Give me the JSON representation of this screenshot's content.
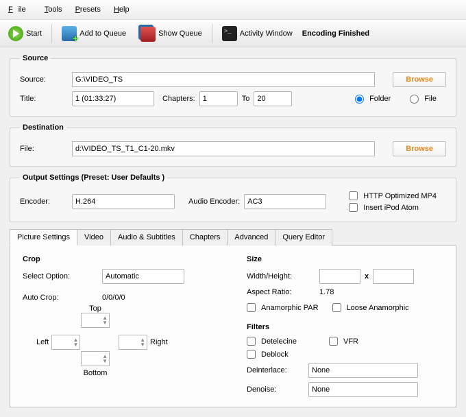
{
  "menu": {
    "file": "File",
    "tools": "Tools",
    "presets": "Presets",
    "help": "Help"
  },
  "toolbar": {
    "start": "Start",
    "add_queue": "Add to Queue",
    "show_queue": "Show Queue",
    "activity": "Activity Window",
    "status": "Encoding Finished"
  },
  "source": {
    "legend": "Source",
    "source_label": "Source:",
    "source_path": "G:\\VIDEO_TS",
    "browse": "Browse",
    "title_label": "Title:",
    "title_value": "1 (01:33:27)",
    "chapters_label": "Chapters:",
    "chapter_start": "1",
    "to_label": "To",
    "chapter_end": "20",
    "folder_label": "Folder",
    "file_label": "File",
    "as_folder": true
  },
  "destination": {
    "legend": "Destination",
    "file_label": "File:",
    "file_path": "d:\\VIDEO_TS_T1_C1-20.mkv",
    "browse": "Browse"
  },
  "output": {
    "legend": "Output Settings (Preset: User Defaults )",
    "encoder_label": "Encoder:",
    "encoder_value": "H.264",
    "audio_encoder_label": "Audio Encoder:",
    "audio_encoder_value": "AC3",
    "http_mp4": "HTTP Optimized MP4",
    "ipod_atom": "Insert iPod Atom"
  },
  "tabs": [
    "Picture Settings",
    "Video",
    "Audio & Subtitles",
    "Chapters",
    "Advanced",
    "Query Editor"
  ],
  "picture": {
    "crop_title": "Crop",
    "select_option_label": "Select Option:",
    "select_option_value": "Automatic",
    "auto_crop_label": "Auto Crop:",
    "auto_crop_value": "0/0/0/0",
    "top": "Top",
    "left": "Left",
    "right": "Right",
    "bottom": "Bottom",
    "size_title": "Size",
    "wh_label": "Width/Height:",
    "x_label": "x",
    "aspect_label": "Aspect Ratio:",
    "aspect_value": "1.78",
    "anamorphic_par": "Anamorphic PAR",
    "loose_anamorphic": "Loose Anamorphic",
    "filters_title": "Filters",
    "detelecine": "Detelecine",
    "vfr": "VFR",
    "deblock": "Deblock",
    "deinterlace_label": "Deinterlace:",
    "deinterlace_value": "None",
    "denoise_label": "Denoise:",
    "denoise_value": "None"
  }
}
